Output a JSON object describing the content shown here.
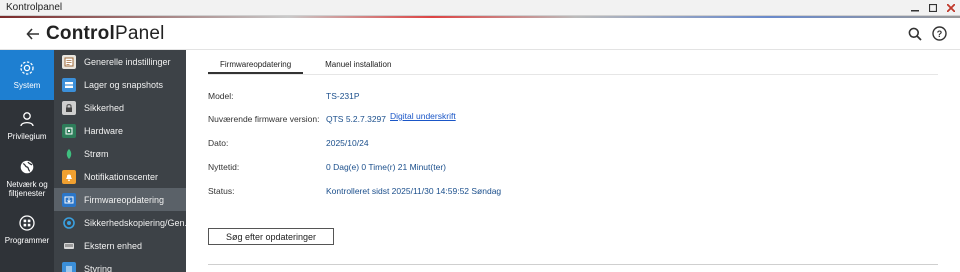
{
  "window": {
    "title": "Kontrolpanel",
    "controls": [
      "minimize",
      "maximize",
      "close"
    ]
  },
  "header": {
    "title_bold": "Control",
    "title_light": "Panel",
    "icons": [
      "back-arrow-icon",
      "search-icon",
      "help-icon"
    ]
  },
  "rail": {
    "items": [
      {
        "label": "System",
        "icon": "gear-icon",
        "active": true
      },
      {
        "label": "Privilegium",
        "icon": "user-icon",
        "active": false
      },
      {
        "label": "Netværk og filtjenester",
        "icon": "globe-icon",
        "active": false
      },
      {
        "label": "Programmer",
        "icon": "apps-grid-icon",
        "active": false
      }
    ]
  },
  "menu": {
    "items": [
      {
        "label": "Generelle indstillinger",
        "icon": "settings-doc-icon"
      },
      {
        "label": "Lager og snapshots",
        "icon": "storage-icon"
      },
      {
        "label": "Sikkerhed",
        "icon": "lock-icon"
      },
      {
        "label": "Hardware",
        "icon": "hardware-icon"
      },
      {
        "label": "Strøm",
        "icon": "power-icon"
      },
      {
        "label": "Notifikationscenter",
        "icon": "notification-icon"
      },
      {
        "label": "Firmwareopdatering",
        "icon": "firmware-icon",
        "active": true
      },
      {
        "label": "Sikkerhedskopiering/Gen...",
        "icon": "backup-icon"
      },
      {
        "label": "Ekstern enhed",
        "icon": "external-device-icon"
      },
      {
        "label": "Styring",
        "icon": "control-icon"
      }
    ]
  },
  "tabs": [
    {
      "label": "Firmwareopdatering",
      "active": true
    },
    {
      "label": "Manuel installation",
      "active": false
    }
  ],
  "info": {
    "model_label": "Model:",
    "model_value": "TS-231P",
    "firmware_label": "Nuværende firmware version:",
    "firmware_value": "QTS 5.2.7.3297",
    "firmware_link": "Digital underskrift",
    "date_label": "Dato:",
    "date_value": "2025/10/24",
    "uptime_label": "Nyttetid:",
    "uptime_value": "0 Dag(e) 0 Time(r) 21 Minut(ter)",
    "status_label": "Status:",
    "status_value": "Kontrolleret sidst 2025/11/30 14:59:52 Søndag"
  },
  "actions": {
    "check_label": "Søg efter opdateringer"
  },
  "colors": {
    "rail_bg": "#2f3338",
    "rail_active": "#1e7fd1",
    "menu_bg": "#3d4247",
    "menu_active": "#5a6168",
    "value_text": "#1b4f8c"
  }
}
